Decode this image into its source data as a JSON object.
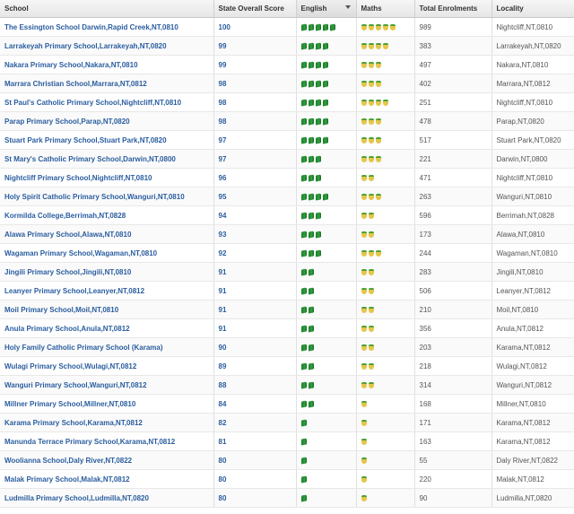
{
  "headers": {
    "school": "School",
    "score": "State Overall Score",
    "english": "English",
    "maths": "Maths",
    "enrolments": "Total Enrolments",
    "locality": "Locality"
  },
  "icons": {
    "english": "book-icon",
    "maths": "apple-icon"
  },
  "colors": {
    "link": "#2a5d9f",
    "book": "#2ea33e",
    "apple": "#e6c54a"
  },
  "rows": [
    {
      "school": "The Essington School Darwin,Rapid Creek,NT,0810",
      "score": "100",
      "english": 5,
      "maths": 5,
      "enrolments": "989",
      "locality": "Nightcliff,NT,0810"
    },
    {
      "school": "Larrakeyah Primary School,Larrakeyah,NT,0820",
      "score": "99",
      "english": 4,
      "maths": 4,
      "enrolments": "383",
      "locality": "Larrakeyah,NT,0820"
    },
    {
      "school": "Nakara Primary School,Nakara,NT,0810",
      "score": "99",
      "english": 4,
      "maths": 3,
      "enrolments": "497",
      "locality": "Nakara,NT,0810"
    },
    {
      "school": "Marrara Christian School,Marrara,NT,0812",
      "score": "98",
      "english": 4,
      "maths": 3,
      "enrolments": "402",
      "locality": "Marrara,NT,0812"
    },
    {
      "school": "St Paul's Catholic Primary School,Nightcliff,NT,0810",
      "score": "98",
      "english": 4,
      "maths": 4,
      "enrolments": "251",
      "locality": "Nightcliff,NT,0810"
    },
    {
      "school": "Parap Primary School,Parap,NT,0820",
      "score": "98",
      "english": 4,
      "maths": 3,
      "enrolments": "478",
      "locality": "Parap,NT,0820"
    },
    {
      "school": "Stuart Park Primary School,Stuart Park,NT,0820",
      "score": "97",
      "english": 4,
      "maths": 3,
      "enrolments": "517",
      "locality": "Stuart Park,NT,0820"
    },
    {
      "school": "St Mary's Catholic Primary School,Darwin,NT,0800",
      "score": "97",
      "english": 3,
      "maths": 3,
      "enrolments": "221",
      "locality": "Darwin,NT,0800"
    },
    {
      "school": "Nightcliff Primary School,Nightcliff,NT,0810",
      "score": "96",
      "english": 3,
      "maths": 2,
      "enrolments": "471",
      "locality": "Nightcliff,NT,0810"
    },
    {
      "school": "Holy Spirit Catholic Primary School,Wanguri,NT,0810",
      "score": "95",
      "english": 4,
      "maths": 3,
      "enrolments": "263",
      "locality": "Wanguri,NT,0810"
    },
    {
      "school": "Kormilda College,Berrimah,NT,0828",
      "score": "94",
      "english": 3,
      "maths": 2,
      "enrolments": "596",
      "locality": "Berrimah,NT,0828"
    },
    {
      "school": "Alawa Primary School,Alawa,NT,0810",
      "score": "93",
      "english": 3,
      "maths": 2,
      "enrolments": "173",
      "locality": "Alawa,NT,0810"
    },
    {
      "school": "Wagaman Primary School,Wagaman,NT,0810",
      "score": "92",
      "english": 3,
      "maths": 3,
      "enrolments": "244",
      "locality": "Wagaman,NT,0810"
    },
    {
      "school": "Jingili Primary School,Jingili,NT,0810",
      "score": "91",
      "english": 2,
      "maths": 2,
      "enrolments": "283",
      "locality": "Jingili,NT,0810"
    },
    {
      "school": "Leanyer Primary School,Leanyer,NT,0812",
      "score": "91",
      "english": 2,
      "maths": 2,
      "enrolments": "506",
      "locality": "Leanyer,NT,0812"
    },
    {
      "school": "Moil Primary School,Moil,NT,0810",
      "score": "91",
      "english": 2,
      "maths": 2,
      "enrolments": "210",
      "locality": "Moil,NT,0810"
    },
    {
      "school": "Anula Primary School,Anula,NT,0812",
      "score": "91",
      "english": 2,
      "maths": 2,
      "enrolments": "356",
      "locality": "Anula,NT,0812"
    },
    {
      "school": "Holy Family Catholic Primary School (Karama)",
      "score": "90",
      "english": 2,
      "maths": 2,
      "enrolments": "203",
      "locality": "Karama,NT,0812"
    },
    {
      "school": "Wulagi Primary School,Wulagi,NT,0812",
      "score": "89",
      "english": 2,
      "maths": 2,
      "enrolments": "218",
      "locality": "Wulagi,NT,0812"
    },
    {
      "school": "Wanguri Primary School,Wanguri,NT,0812",
      "score": "88",
      "english": 2,
      "maths": 2,
      "enrolments": "314",
      "locality": "Wanguri,NT,0812"
    },
    {
      "school": "Millner Primary School,Millner,NT,0810",
      "score": "84",
      "english": 2,
      "maths": 1,
      "enrolments": "168",
      "locality": "Millner,NT,0810"
    },
    {
      "school": "Karama Primary School,Karama,NT,0812",
      "score": "82",
      "english": 1,
      "maths": 1,
      "enrolments": "171",
      "locality": "Karama,NT,0812"
    },
    {
      "school": "Manunda Terrace Primary School,Karama,NT,0812",
      "score": "81",
      "english": 1,
      "maths": 1,
      "enrolments": "163",
      "locality": "Karama,NT,0812"
    },
    {
      "school": "Woolianna School,Daly River,NT,0822",
      "score": "80",
      "english": 1,
      "maths": 1,
      "enrolments": "55",
      "locality": "Daly River,NT,0822"
    },
    {
      "school": "Malak Primary School,Malak,NT,0812",
      "score": "80",
      "english": 1,
      "maths": 1,
      "enrolments": "220",
      "locality": "Malak,NT,0812"
    },
    {
      "school": "Ludmilla Primary School,Ludmilla,NT,0820",
      "score": "80",
      "english": 1,
      "maths": 1,
      "enrolments": "90",
      "locality": "Ludmilla,NT,0820"
    }
  ]
}
